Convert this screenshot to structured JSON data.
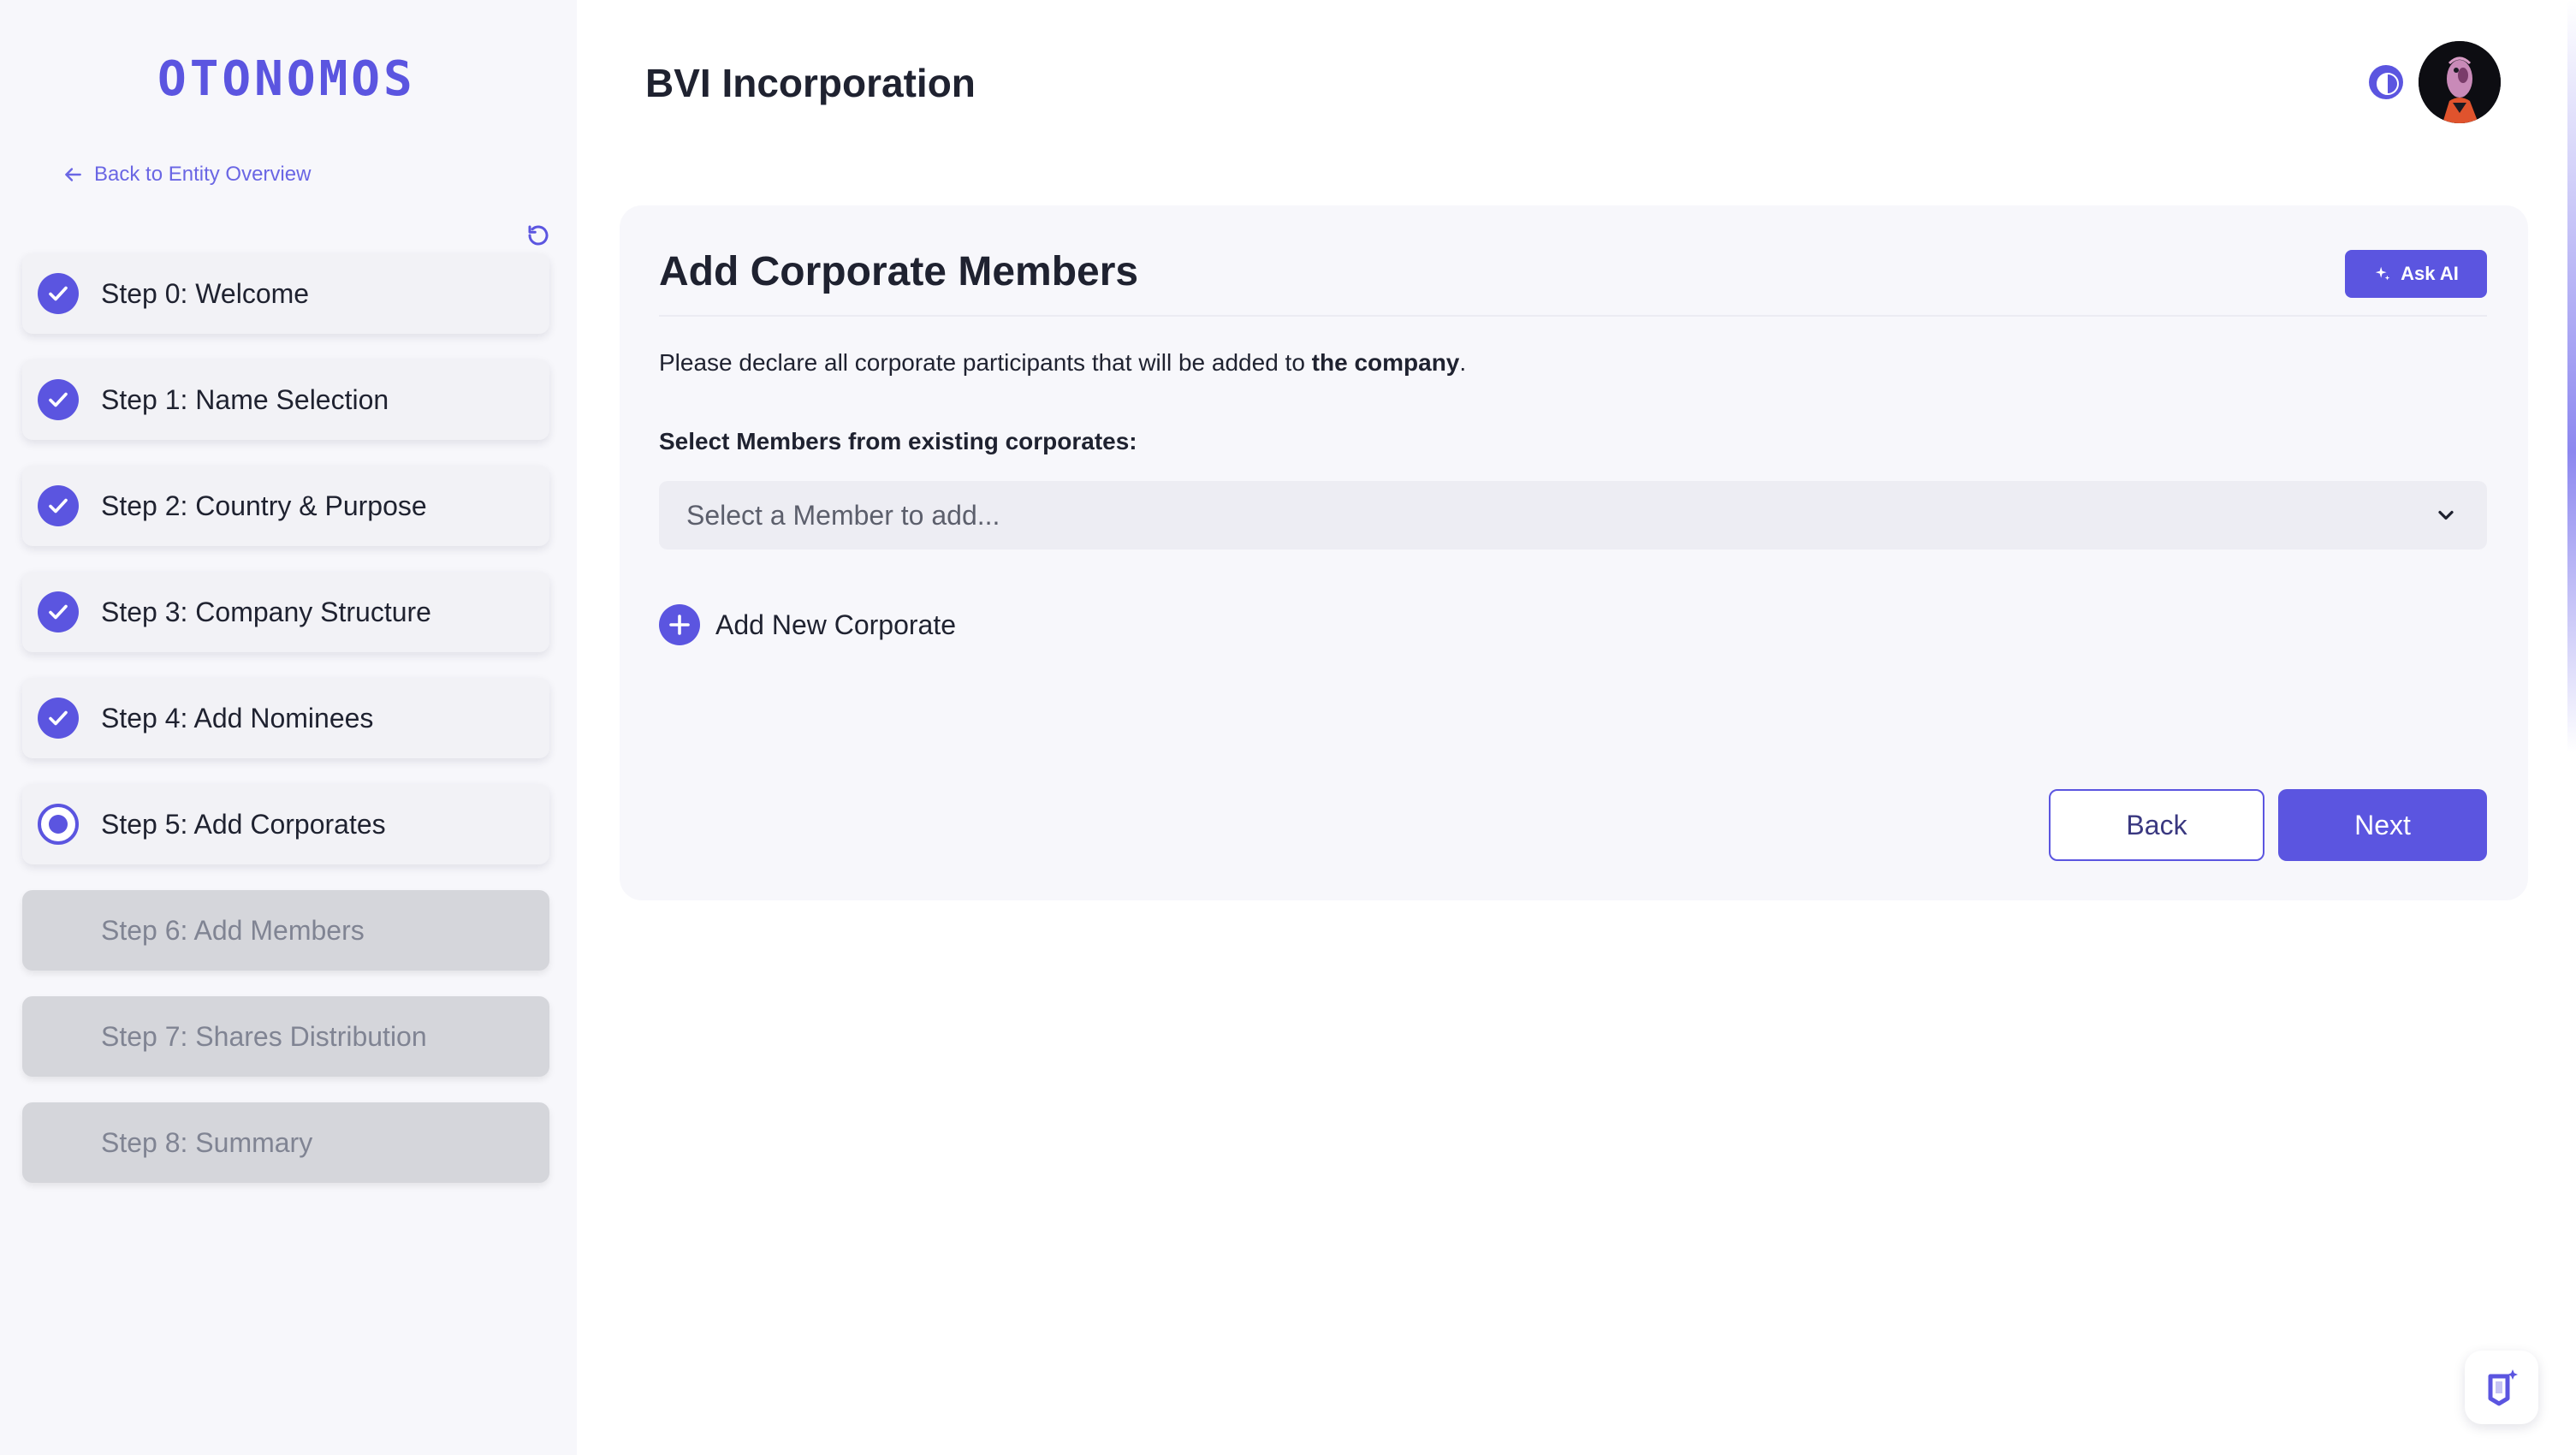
{
  "brand": {
    "logo_text": "OTONOMOS",
    "accent_color": "#5b55e0"
  },
  "sidebar": {
    "back_link": "Back to Entity Overview",
    "steps": [
      {
        "label": "Step 0: Welcome",
        "status": "completed"
      },
      {
        "label": "Step 1: Name Selection",
        "status": "completed"
      },
      {
        "label": "Step 2: Country & Purpose",
        "status": "completed"
      },
      {
        "label": "Step 3: Company Structure",
        "status": "completed"
      },
      {
        "label": "Step 4: Add Nominees",
        "status": "completed"
      },
      {
        "label": "Step 5: Add Corporates",
        "status": "current"
      },
      {
        "label": "Step 6: Add Members",
        "status": "locked"
      },
      {
        "label": "Step 7: Shares Distribution",
        "status": "locked"
      },
      {
        "label": "Step 8: Summary",
        "status": "locked"
      }
    ]
  },
  "header": {
    "title": "BVI Incorporation"
  },
  "card": {
    "title": "Add Corporate Members",
    "ask_ai_label": "Ask AI",
    "description_prefix": "Please declare all corporate participants that will be added to ",
    "description_bold": "the company",
    "description_suffix": ".",
    "select_label": "Select Members from existing corporates:",
    "select_placeholder": "Select a Member to add...",
    "add_new_label": "Add New Corporate",
    "back_label": "Back",
    "next_label": "Next"
  },
  "icons": {
    "back": "arrow-left-icon",
    "reset": "refresh-icon",
    "completed": "check-icon",
    "theme": "contrast-icon",
    "dropdown": "chevron-down-icon",
    "add": "plus-icon",
    "ai": "sparkle-icon",
    "chat": "chat-launcher-icon"
  }
}
